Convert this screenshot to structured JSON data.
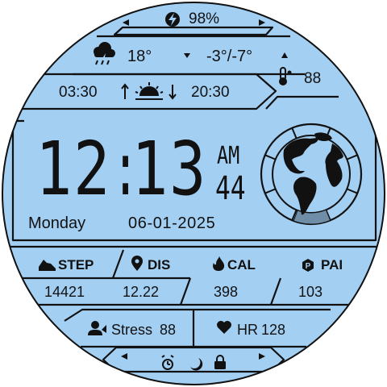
{
  "colors": {
    "face": "#a3cff3",
    "ink": "#111111",
    "progress": "#6f8da6"
  },
  "battery": {
    "icon": "bolt-icon",
    "value": "98%"
  },
  "weather": {
    "icon": "cloud-rain-icon",
    "temp": "18°",
    "range": "-3°/-7°",
    "thermo_icon": "thermometer-icon",
    "uv": "88"
  },
  "sun": {
    "sunrise": "03:30",
    "sunset": "20:30",
    "icon": "sunrise-icon"
  },
  "time": {
    "hours": "12",
    "minutes": "13",
    "ampm": "AM",
    "seconds": "44"
  },
  "date": {
    "weekday": "Monday",
    "date": "06-01-2025"
  },
  "globe": {
    "icon": "globe-icon",
    "progress": 0.12
  },
  "stats": [
    {
      "icon": "shoe-icon",
      "label": "STEP",
      "value": "14421"
    },
    {
      "icon": "location-pin-icon",
      "label": "DIS",
      "value": "12.22"
    },
    {
      "icon": "flame-icon",
      "label": "CAL",
      "value": "398"
    },
    {
      "icon": "pai-icon",
      "label": "PAI",
      "value": "103"
    }
  ],
  "stress": {
    "icon": "stress-person-icon",
    "label": "Stress",
    "value": "88"
  },
  "heart": {
    "icon": "heart-icon",
    "label": "HR",
    "value": "128"
  },
  "bottom": {
    "icons": [
      "alarm-icon",
      "moon-icon",
      "lock-icon"
    ]
  }
}
